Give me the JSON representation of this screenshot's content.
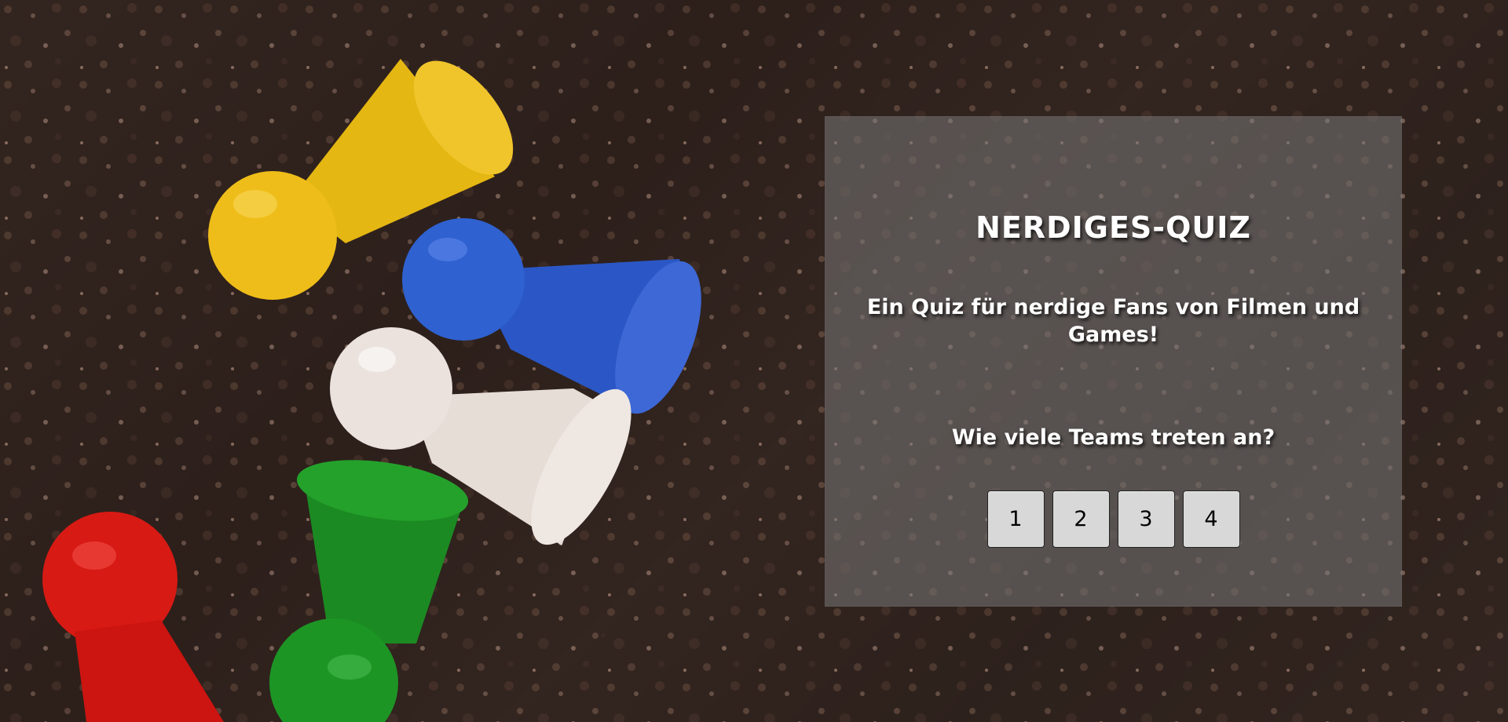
{
  "colors": {
    "card_background": "#787878",
    "text": "#ffffff",
    "button_background": "#d8d8d8",
    "pawn_yellow": "#e6b80f",
    "pawn_blue": "#2f5ac8",
    "pawn_white": "#e8dfd8",
    "pawn_green": "#1b8a22",
    "pawn_red": "#d81a14"
  },
  "icons": [
    "yellow-pawn-icon",
    "blue-pawn-icon",
    "white-pawn-icon",
    "green-pawn-icon",
    "red-pawn-icon"
  ],
  "header": {
    "title": "NERDIGES-QUIZ",
    "subtitle": "Ein Quiz für nerdige Fans von Filmen und Games!"
  },
  "setup": {
    "question": "Wie viele Teams treten an?",
    "team_options": [
      "1",
      "2",
      "3",
      "4"
    ]
  }
}
